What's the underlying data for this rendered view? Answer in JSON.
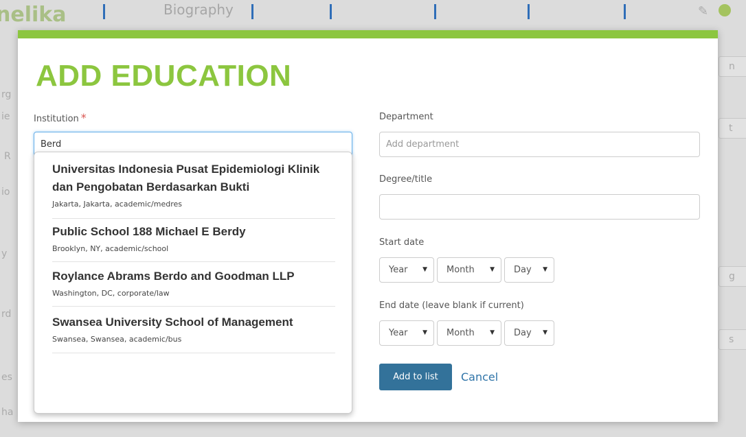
{
  "background": {
    "profile_name": "nelika",
    "tab_label": "Biography",
    "side_fragments": [
      "rg",
      "ie",
      "R",
      "io",
      "y",
      "rd",
      "es",
      "ha"
    ],
    "right_fragments": [
      "n",
      "t",
      "g",
      "s"
    ]
  },
  "modal": {
    "title": "ADD EDUCATION",
    "institution": {
      "label": "Institution",
      "required_mark": "*",
      "value": "Berd"
    },
    "department": {
      "label": "Department",
      "placeholder": "Add department",
      "value": ""
    },
    "degree": {
      "label": "Degree/title",
      "value": ""
    },
    "start_date": {
      "label": "Start date",
      "year": "Year",
      "month": "Month",
      "day": "Day"
    },
    "end_date": {
      "label": "End date (leave blank if current)",
      "year": "Year",
      "month": "Month",
      "day": "Day"
    },
    "add_button": "Add to list",
    "cancel_link": "Cancel"
  },
  "autocomplete": {
    "items": [
      {
        "name": "Universitas Indonesia Pusat Epidemiologi Klinik dan Pengobatan Berdasarkan Bukti",
        "meta": "Jakarta, Jakarta, academic/medres"
      },
      {
        "name": "Public School 188 Michael E Berdy",
        "meta": "Brooklyn, NY, academic/school"
      },
      {
        "name": "Roylance Abrams Berdo and Goodman LLP",
        "meta": "Washington, DC, corporate/law"
      },
      {
        "name": "Swansea University School of Management",
        "meta": "Swansea, Swansea, academic/bus"
      }
    ]
  },
  "colors": {
    "accent_green": "#8cc63f",
    "button_blue": "#33729a",
    "link_blue": "#2f74a8",
    "required_red": "#d9534f"
  },
  "icons": {
    "select_caret": "▼",
    "edit": "✎"
  }
}
